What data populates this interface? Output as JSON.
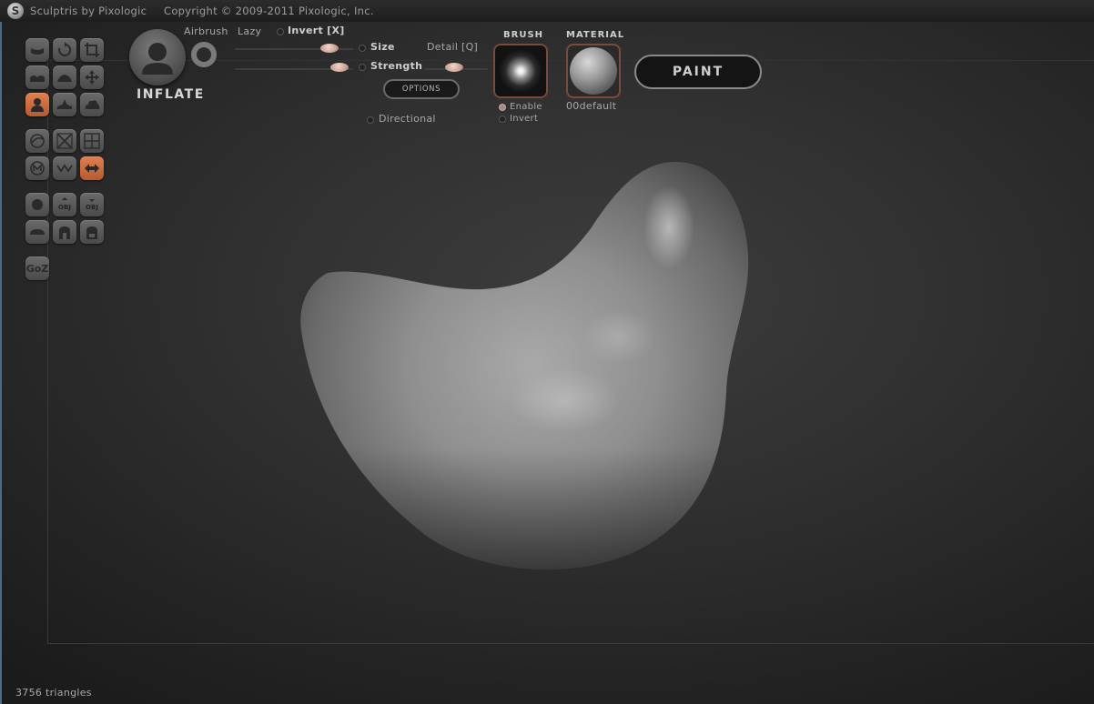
{
  "window": {
    "title": "Sculptris by Pixologic",
    "copyright": "Copyright © 2009-2011 Pixologic, Inc.",
    "logo_glyph": "S"
  },
  "brush": {
    "name": "INFLATE",
    "airbrush_label": "Airbrush",
    "lazy_label": "Lazy",
    "invert_label": "Invert [X]",
    "size_label": "Size",
    "size_level": 0.85,
    "strength_label": "Strength",
    "strength_level": 0.95,
    "detail_label": "Detail [Q]",
    "detail_level": 0.45,
    "options_label": "OPTIONS",
    "directional_label": "Directional"
  },
  "brush_preview": {
    "title": "BRUSH",
    "enable_label": "Enable",
    "invert_label": "Invert"
  },
  "material": {
    "title": "MATERIAL",
    "name": "00default"
  },
  "mode_button": {
    "label": "PAINT"
  },
  "goz_label": "GoZ",
  "obj_label": "OBJ",
  "status": {
    "triangles": "3756 triangles"
  },
  "colors": {
    "accent": "#d06b3a",
    "background": "#1c1c1c",
    "selection_frame": "#7a4a3c"
  }
}
